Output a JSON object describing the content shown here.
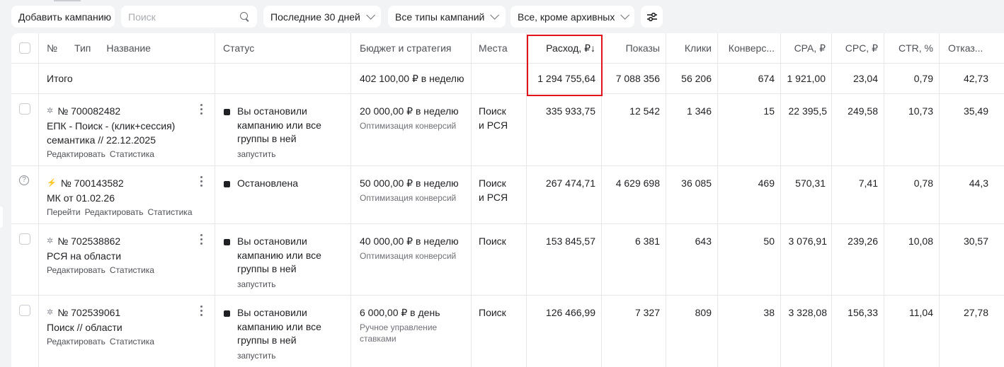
{
  "toolbar": {
    "add_campaign": "Добавить кампанию",
    "search_placeholder": "Поиск",
    "period": "Последние 30 дней",
    "types": "Все типы кампаний",
    "archive": "Все, кроме архивных"
  },
  "columns": {
    "num": "№",
    "type": "Тип",
    "name": "Название",
    "status": "Статус",
    "budget": "Бюджет и стратегия",
    "places": "Места",
    "spend": "Расход, ₽↓",
    "impressions": "Показы",
    "clicks": "Клики",
    "conversions": "Конверс...",
    "cpa": "CPA, ₽",
    "cpc": "CPC, ₽",
    "ctr": "CTR, %",
    "bounce": "Отказ..."
  },
  "totals": {
    "label": "Итого",
    "budget": "402 100,00 ₽ в неделю",
    "spend": "1 294 755,64",
    "impressions": "7 088 356",
    "clicks": "56 206",
    "conversions": "674",
    "cpa": "1 921,00",
    "cpc": "23,04",
    "ctr": "0,79",
    "bounce": "42,73"
  },
  "rows": [
    {
      "id": "№ 700082482",
      "name_l1": "ЕПК - Поиск - (клик+сессия)",
      "name_l2": "семантика // 22.12.2025",
      "link1": "Редактировать",
      "link2": "Статистика",
      "status_l1": "Вы остановили",
      "status_l2": "кампанию или все",
      "status_l3": "группы в ней",
      "status_action": "запустить",
      "budget": "20 000,00 ₽ в неделю",
      "strategy_l1": "Оптимизация конверсий",
      "places_l1": "Поиск",
      "places_l2": "и РСЯ",
      "spend": "335 933,75",
      "impressions": "12 542",
      "clicks": "1 346",
      "conversions": "15",
      "cpa": "22 395,5",
      "cpc": "249,58",
      "ctr": "10,73",
      "bounce": "35,49"
    },
    {
      "id": "№ 700143582",
      "name_l1": "МК от 01.02.26",
      "link0": "Перейти",
      "link1": "Редактировать",
      "link2": "Статистика",
      "status_l1": "Остановлена",
      "budget": "50 000,00 ₽ в неделю",
      "strategy_l1": "Оптимизация конверсий",
      "places_l1": "Поиск",
      "places_l2": "и РСЯ",
      "spend": "267 474,71",
      "impressions": "4 629 698",
      "clicks": "36 085",
      "conversions": "469",
      "cpa": "570,31",
      "cpc": "7,41",
      "ctr": "0,78",
      "bounce": "44,3"
    },
    {
      "id": "№ 702538862",
      "name_l1": "РСЯ на области",
      "link1": "Редактировать",
      "link2": "Статистика",
      "status_l1": "Вы остановили",
      "status_l2": "кампанию или все",
      "status_l3": "группы в ней",
      "status_action": "запустить",
      "budget": "40 000,00 ₽ в неделю",
      "strategy_l1": "Оптимизация конверсий",
      "places_l1": "Поиск",
      "spend": "153 845,57",
      "impressions": "6 381",
      "clicks": "643",
      "conversions": "50",
      "cpa": "3 076,91",
      "cpc": "239,26",
      "ctr": "10,08",
      "bounce": "30,57"
    },
    {
      "id": "№ 702539061",
      "name_l1": "Поиск // области",
      "link1": "Редактировать",
      "link2": "Статистика",
      "status_l1": "Вы остановили",
      "status_l2": "кампанию или все",
      "status_l3": "группы в ней",
      "status_action": "запустить",
      "budget": "6 000,00 ₽ в день",
      "strategy_l1": "Ручное управление",
      "strategy_l2": "ставками",
      "places_l1": "Поиск",
      "spend": "126 466,99",
      "impressions": "7 327",
      "clicks": "809",
      "conversions": "38",
      "cpa": "3 328,08",
      "cpc": "156,33",
      "ctr": "11,04",
      "bounce": "27,78"
    }
  ],
  "colors": {
    "highlight": "#e3131b",
    "background": "#f2f3f5"
  }
}
